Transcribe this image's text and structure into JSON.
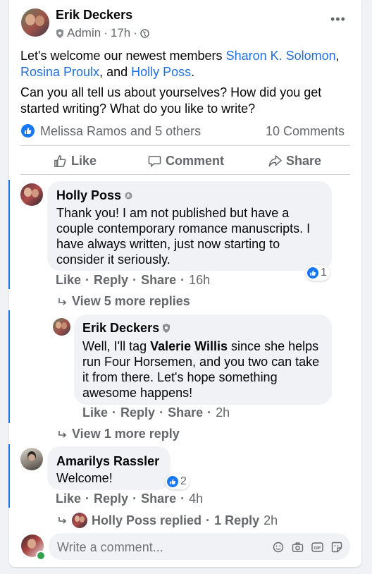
{
  "post": {
    "author": "Erik Deckers",
    "role": "Admin",
    "time": "17h",
    "line1_prefix": "Let's welcome our newest members ",
    "mention1": "Sharon K. Solomon",
    "sep1": ", ",
    "mention2": "Rosina Proulx",
    "sep2": ", and ",
    "mention3": "Holly Poss",
    "line1_suffix": ".",
    "line2": "Can you all tell us about yourselves? How did you get started writing? What do you like to write?",
    "reactions_text": "Melissa Ramos and 5 others",
    "comments_count": "10 Comments",
    "more_icon": "more-horizontal-icon"
  },
  "actions": {
    "like": "Like",
    "comment": "Comment",
    "share": "Share"
  },
  "comments": [
    {
      "author": "Holly Poss",
      "text": "Thank you! I am not published but have a couple contemporary romance manuscripts. I have always written, just now starting to consider it seriously.",
      "like": "Like",
      "reply": "Reply",
      "share": "Share",
      "time": "16h",
      "reaction_count": "1",
      "view_more": "View 5 more replies"
    },
    {
      "author": "Erik Deckers",
      "text_prefix": "Well, I'll tag ",
      "mention": "Valerie Willis",
      "text_suffix": " since she helps run Four Horsemen, and you two can take it from there. Let's hope something awesome happens!",
      "like": "Like",
      "reply": "Reply",
      "share": "Share",
      "time": "2h",
      "view_more": "View 1 more reply"
    },
    {
      "author": "Amarilys Rassler",
      "text": "Welcome!",
      "like": "Like",
      "reply": "Reply",
      "share": "Share",
      "time": "4h",
      "reaction_count": "2",
      "replied_author": "Holly Poss replied",
      "replied_count": "1 Reply",
      "replied_time": "2h"
    }
  ],
  "composer": {
    "placeholder": "Write a comment..."
  },
  "colors": {
    "link": "#216fdb",
    "like_blue": "#1877f2",
    "thread_line": "#1877f2",
    "muted": "#65676b",
    "bubble": "#f0f2f5"
  }
}
